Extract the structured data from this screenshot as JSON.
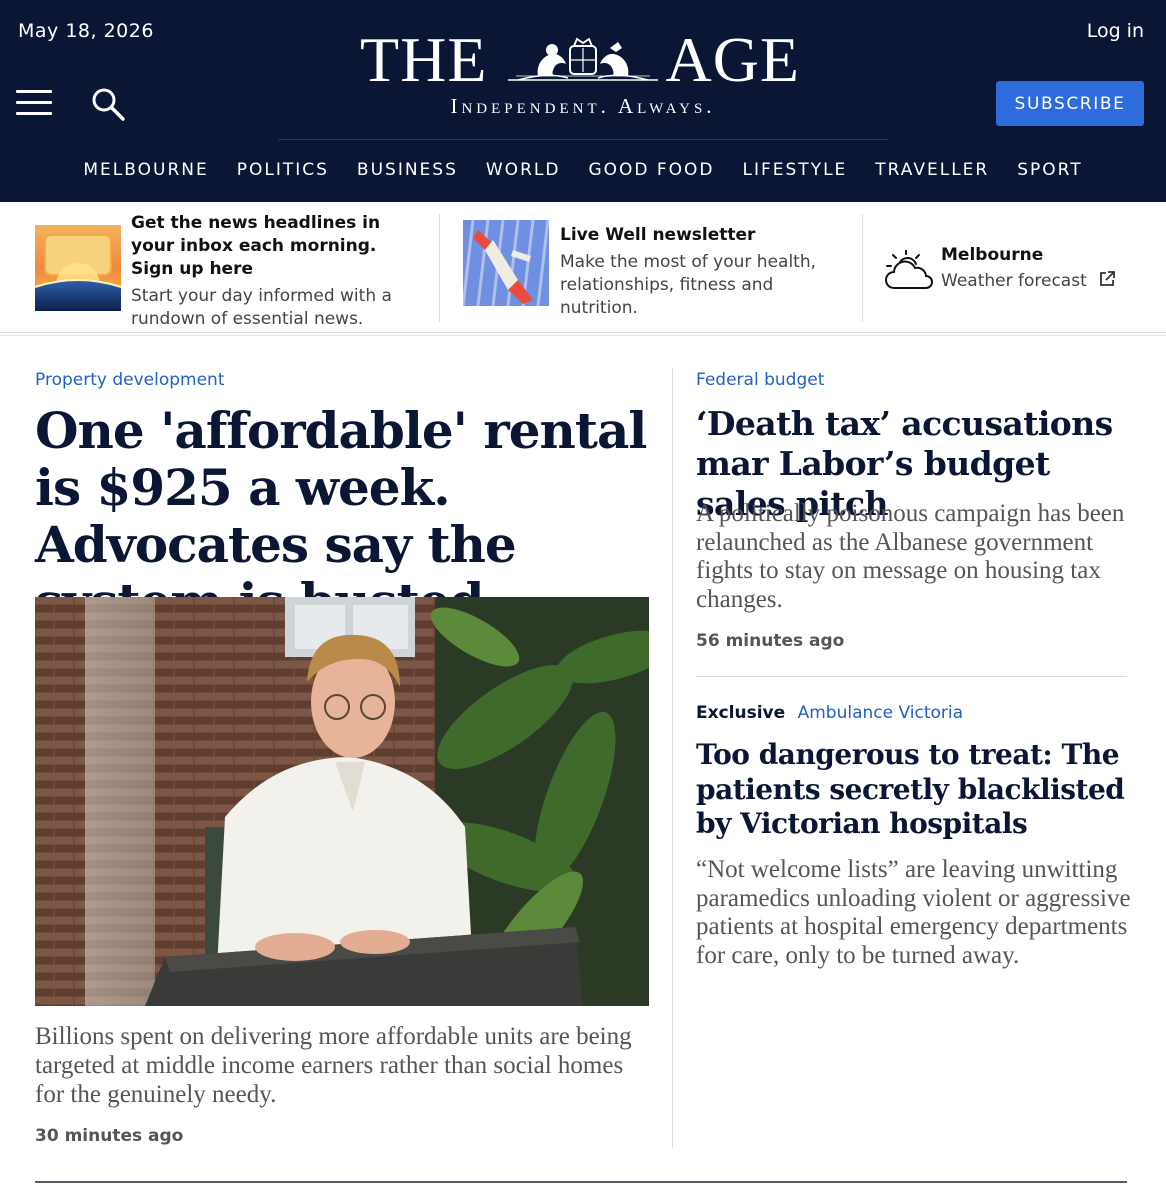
{
  "header": {
    "date": "May 18, 2026",
    "login_label": "Log in",
    "logo_left": "THE",
    "logo_right": "AGE",
    "tagline": "Independent. Always.",
    "subscribe_label": "SUBSCRIBE",
    "nav": [
      "MELBOURNE",
      "POLITICS",
      "BUSINESS",
      "WORLD",
      "GOOD FOOD",
      "LIFESTYLE",
      "TRAVELLER",
      "SPORT"
    ]
  },
  "promos": {
    "morning": {
      "title": "Get the news headlines in your inbox each morning. Sign up here",
      "desc": "Start your day informed with a rundown of essential news."
    },
    "livewell": {
      "title": "Live Well newsletter",
      "desc": "Make the most of your health, relationships, fitness and nutrition."
    },
    "weather": {
      "title": "Melbourne",
      "desc": "Weather forecast"
    }
  },
  "lead": {
    "kicker": "Property development",
    "headline": "One 'affordable' rental is $925 a week. Advocates say the system is busted",
    "summary": "Billions spent on delivering more affordable units are being targeted at middle income earners rather than social homes for the genuinely needy.",
    "time": "30 minutes ago"
  },
  "side1": {
    "kicker": "Federal budget",
    "headline": "‘Death tax’ accusations mar Labor’s budget sales pitch",
    "summary": "A politically poisonous campaign has been relaunched as the Albanese government fights to stay on message on housing tax changes.",
    "time": "56 minutes ago"
  },
  "side2": {
    "label": "Exclusive",
    "kicker": "Ambulance Victoria",
    "headline": "Too dangerous to treat: The patients secretly blacklisted by Victorian hospitals",
    "summary": "“Not welcome lists” are leaving unwitting paramedics unloading violent or aggressive patients at hospital emergency departments for care, only to be turned away."
  },
  "colors": {
    "masthead": "#0a1633",
    "accent": "#2e6cdc",
    "kicker": "#2160c4"
  },
  "icons": [
    "menu-icon",
    "search-icon",
    "crest-icon",
    "weather-cloud-sun-icon",
    "external-link-icon"
  ]
}
